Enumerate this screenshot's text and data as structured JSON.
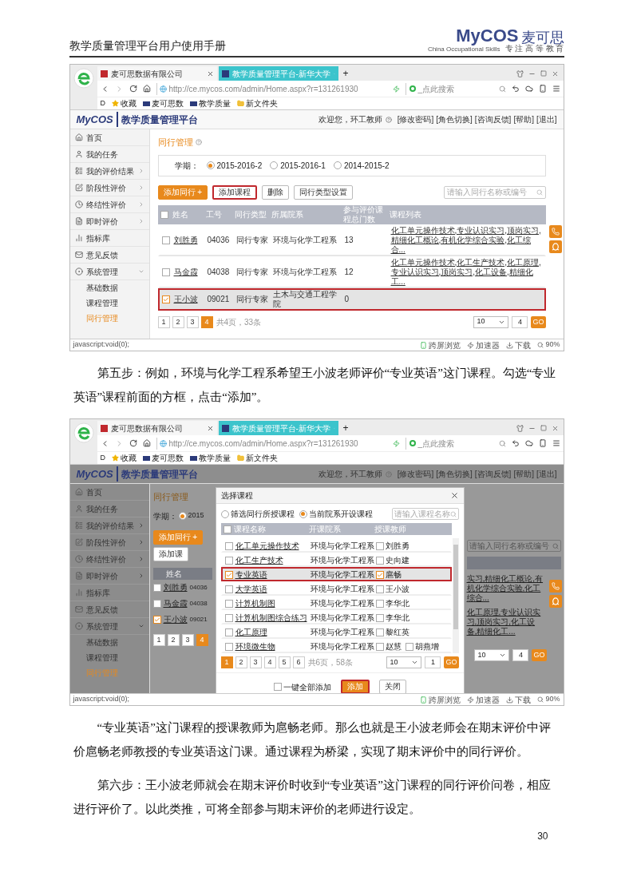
{
  "doc_header": {
    "title": "教学质量管理平台用户使用手册",
    "logo": "MyCOS",
    "logo_cn": "麦可思",
    "logo_tagline": "China Occupational Skills",
    "logo_slogan": "专 注 高 等 教 育"
  },
  "content": [
    {
      "kind": "screenshot",
      "dimmed": false,
      "browser": {
        "tabs": [
          {
            "title": "麦可思数据有限公司",
            "selected": false
          },
          {
            "title": "教学质量管理平台-新华大学",
            "selected": true
          }
        ],
        "new_tab": "+",
        "url": "http://ce.mycos.com/admin/Home.aspx?r=131261930",
        "search_placeholder": "_点此搜索",
        "bookmarks_label": "D",
        "bookmarks": [
          "收藏",
          "麦可思数",
          "教学质量",
          "新文件夹"
        ],
        "status_text": "javascript:void(0);",
        "status_items": [
          "跨屏浏览",
          "加速器",
          "下载"
        ],
        "zoom": "90%"
      },
      "app": {
        "brand": "MyCOS",
        "title": "教学质量管理平台",
        "welcome": "欢迎您，环工教师",
        "links": [
          "[修改密码]",
          "[角色切换]",
          "[咨询反馈]",
          "[帮助]",
          "[退出]"
        ]
      },
      "sidebar": [
        {
          "label": "首页"
        },
        {
          "label": "我的任务"
        },
        {
          "label": "我的评价结果",
          "expanded": false
        },
        {
          "label": "阶段性评价",
          "expanded": false
        },
        {
          "label": "终结性评价",
          "expanded": false
        },
        {
          "label": "即时评价",
          "expanded": false
        },
        {
          "label": "指标库"
        },
        {
          "label": "意见反馈"
        },
        {
          "label": "系统管理",
          "expanded": true,
          "children": [
            {
              "label": "基础数据",
              "selected": false
            },
            {
              "label": "课程管理",
              "selected": false
            },
            {
              "label": "同行管理",
              "selected": true
            }
          ]
        }
      ],
      "main": {
        "title": "同行管理",
        "term_label": "学期：",
        "terms": [
          {
            "label": "2015-2016-2",
            "selected": true
          },
          {
            "label": "2015-2016-1",
            "selected": false
          },
          {
            "label": "2014-2015-2",
            "selected": false
          }
        ],
        "buttons": [
          {
            "label": "添加同行 +",
            "kind": "primary",
            "highlighted": false
          },
          {
            "label": "添加课程",
            "kind": "default",
            "highlighted": true
          },
          {
            "label": "删除",
            "kind": "default",
            "highlighted": false
          },
          {
            "label": "同行类型设置",
            "kind": "default",
            "highlighted": false
          }
        ],
        "search_placeholder": "请输入同行名称或编号",
        "table": {
          "header_checked": false,
          "columns": [
            "姓名",
            "工号",
            "同行类型",
            "所属院系",
            "参与评价课程总门数",
            "课程列表"
          ],
          "rows": [
            {
              "checked": false,
              "highlighted": false,
              "cells": [
                "刘胜勇",
                "04036",
                "同行专家",
                "环境与化学工程系",
                "13",
                "化工单元操作技术,专业认识实习,顶岗实习,精细化工概论,有机化学综合实验,化工综合..."
              ]
            },
            {
              "checked": false,
              "highlighted": false,
              "cells": [
                "马金霞",
                "04038",
                "同行专家",
                "环境与化学工程系",
                "12",
                "化工单元操作技术,化工生产技术,化工原理,专业认识实习,顶岗实习,化工设备,精细化工..."
              ]
            },
            {
              "checked": true,
              "highlighted": true,
              "cells": [
                "王小波",
                "09021",
                "同行专家",
                "土木与交通工程学院",
                "0",
                ""
              ]
            }
          ]
        },
        "pagination": {
          "pages": [
            {
              "label": "1",
              "selected": false
            },
            {
              "label": "2",
              "selected": false
            },
            {
              "label": "3",
              "selected": false
            },
            {
              "label": "4",
              "selected": true
            }
          ],
          "summary": "共4页，33条",
          "page_size": "10",
          "jump": "4",
          "go": "GO"
        }
      }
    },
    {
      "kind": "paragraph",
      "text": "第五步：例如，环境与化学工程系希望王小波老师评价“专业英语”这门课程。勾选“专业英语”课程前面的方框，点击“添加”。"
    },
    {
      "kind": "screenshot",
      "dimmed": true,
      "browser": {
        "tabs": [
          {
            "title": "麦可思数据有限公司",
            "selected": false
          },
          {
            "title": "教学质量管理平台-新华大学",
            "selected": true
          }
        ],
        "new_tab": "+",
        "url": "http://ce.mycos.com/admin/Home.aspx?r=131261930",
        "search_placeholder": "_点此搜索",
        "bookmarks_label": "D",
        "bookmarks": [
          "收藏",
          "麦可思数",
          "教学质量",
          "新文件夹"
        ],
        "status_text": "javascript:void(0);",
        "status_items": [
          "跨屏浏览",
          "加速器",
          "下载"
        ],
        "zoom": "90%"
      },
      "app": {
        "brand": "MyCOS",
        "title": "教学质量管理平台",
        "welcome": "欢迎您，环工教师",
        "links": [
          "[修改密码]",
          "[角色切换]",
          "[咨询反馈]",
          "[帮助]",
          "[退出]"
        ]
      },
      "sidebar": [
        {
          "label": "首页"
        },
        {
          "label": "我的任务"
        },
        {
          "label": "我的评价结果",
          "expanded": false
        },
        {
          "label": "阶段性评价",
          "expanded": false
        },
        {
          "label": "终结性评价",
          "expanded": false
        },
        {
          "label": "即时评价",
          "expanded": false
        },
        {
          "label": "指标库"
        },
        {
          "label": "意见反馈"
        },
        {
          "label": "系统管理",
          "expanded": true,
          "children": [
            {
              "label": "基础数据",
              "selected": false
            },
            {
              "label": "课程管理",
              "selected": false
            },
            {
              "label": "同行管理",
              "selected": true
            }
          ]
        }
      ],
      "backdrop": {
        "title": "同行管理",
        "term_label": "学期：",
        "term": {
          "label": "2015",
          "selected": true
        },
        "buttons": [
          {
            "label": "添加同行 +",
            "kind": "primary"
          },
          {
            "label": "添加课",
            "kind": "default"
          }
        ],
        "column": "姓名",
        "rows": [
          {
            "checked": false,
            "name": "刘胜勇",
            "id": "04036"
          },
          {
            "checked": false,
            "name": "马金霞",
            "id": "04038"
          },
          {
            "checked": true,
            "name": "王小波",
            "id": "09021"
          }
        ],
        "pages": [
          {
            "label": "1",
            "selected": false
          },
          {
            "label": "2",
            "selected": false
          },
          {
            "label": "3",
            "selected": false
          },
          {
            "label": "4",
            "selected": true
          }
        ],
        "search_placeholder": "请输入同行名称或编号",
        "course_fragments": [
          "实习,精细化工概论,有机化学综合实验,化工综合...",
          "化工原理,专业认识实习,顶岗实习,化工设备,精细化工..."
        ],
        "page_size": "10",
        "jump": "4",
        "go": "GO"
      },
      "dialog": {
        "title": "选择课程",
        "scopes": [
          {
            "label": "筛选同行所授课程",
            "selected": false
          },
          {
            "label": "当前院系开设课程",
            "selected": true
          }
        ],
        "search_placeholder": "请输入课程名称",
        "header_checked": false,
        "columns": [
          "课程名称",
          "开课院系",
          "授课教师"
        ],
        "rows": [
          {
            "checked": false,
            "highlighted": false,
            "course": "化工单元操作技术",
            "dept": "环境与化学工程系",
            "teachers": [
              {
                "name": "刘胜勇",
                "checked": false
              }
            ]
          },
          {
            "checked": false,
            "highlighted": false,
            "course": "化工生产技术",
            "dept": "环境与化学工程系",
            "teachers": [
              {
                "name": "史向建",
                "checked": false
              }
            ]
          },
          {
            "checked": true,
            "highlighted": true,
            "course": "专业英语",
            "dept": "环境与化学工程系",
            "teachers": [
              {
                "name": "扈畅",
                "checked": true
              }
            ]
          },
          {
            "checked": false,
            "highlighted": false,
            "course": "大学英语",
            "dept": "环境与化学工程系",
            "teachers": [
              {
                "name": "王小波",
                "checked": false
              }
            ]
          },
          {
            "checked": false,
            "highlighted": false,
            "course": "计算机制图",
            "dept": "环境与化学工程系",
            "teachers": [
              {
                "name": "李华北",
                "checked": false
              }
            ]
          },
          {
            "checked": false,
            "highlighted": false,
            "course": "计算机制图综合练习",
            "dept": "环境与化学工程系",
            "teachers": [
              {
                "name": "李华北",
                "checked": false
              }
            ]
          },
          {
            "checked": false,
            "highlighted": false,
            "course": "化工原理",
            "dept": "环境与化学工程系",
            "teachers": [
              {
                "name": "黎红英",
                "checked": false
              }
            ]
          },
          {
            "checked": false,
            "highlighted": false,
            "course": "环境微生物",
            "dept": "环境与化学工程系",
            "teachers": [
              {
                "name": "赵慧",
                "checked": false
              },
              {
                "name": "胡燕增",
                "checked": false
              }
            ]
          }
        ],
        "pages": [
          {
            "label": "1",
            "selected": true
          },
          {
            "label": "2",
            "selected": false
          },
          {
            "label": "3",
            "selected": false
          },
          {
            "label": "4",
            "selected": false
          },
          {
            "label": "5",
            "selected": false
          },
          {
            "label": "6",
            "selected": false
          }
        ],
        "summary": "共6页，58条",
        "page_size": "10",
        "jump": "1",
        "go": "GO",
        "add_all": {
          "label": "一键全部添加",
          "checked": false
        },
        "buttons": [
          {
            "label": "添加",
            "kind": "primary",
            "highlighted": true
          },
          {
            "label": "关闭",
            "kind": "default",
            "highlighted": false
          }
        ]
      }
    },
    {
      "kind": "paragraph",
      "text": "“专业英语”这门课程的授课教师为扈畅老师。那么也就是王小波老师会在期末评价中评价扈畅老师教授的专业英语这门课。通过课程为桥梁，实现了期末评价中的同行评价。"
    },
    {
      "kind": "paragraph",
      "text": "第六步：王小波老师就会在期末评价时收到“专业英语”这门课程的同行评价问卷，相应进行评价了。以此类推，可将全部参与期末评价的老师进行设定。"
    }
  ],
  "page_number": "30"
}
